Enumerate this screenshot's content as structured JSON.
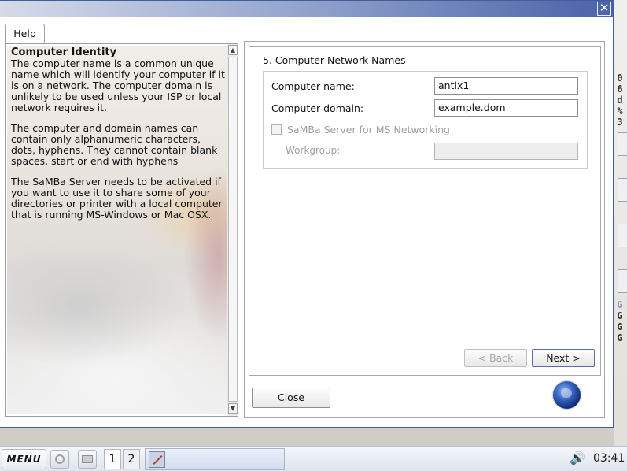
{
  "window": {
    "close_glyph": "✕"
  },
  "help": {
    "tab_label": "Help",
    "heading": "Computer Identity",
    "paragraphs": [
      "The computer name is a common unique name which will identify your computer if it is on a network. The computer domain is unlikely to be used unless your ISP or local network requires it.",
      "The computer and domain names can contain only alphanumeric characters, dots, hyphens. They cannot contain blank spaces, start or end with hyphens",
      "The SaMBa Server needs to be activated if you want to use it to share some of your directories or printer with a local computer that is running MS-Windows or Mac OSX."
    ]
  },
  "form": {
    "section_title": "5. Computer Network Names",
    "computer_name_label": "Computer name:",
    "computer_name_value": "antix1",
    "computer_domain_label": "Computer domain:",
    "computer_domain_value": "example.dom",
    "samba_label": "SaMBa Server for MS Networking",
    "samba_checked": false,
    "workgroup_label": "Workgroup:",
    "workgroup_value": ""
  },
  "buttons": {
    "back": "< Back",
    "next": "Next >",
    "close": "Close"
  },
  "desktop": {
    "right_strip_chars": [
      "0",
      "6",
      "d",
      "%",
      "3"
    ],
    "right_strip_chars_2": [
      "G",
      "G",
      "G",
      "G"
    ]
  },
  "taskbar": {
    "menu_label": "MENU",
    "workspace_1": "1",
    "workspace_2": "2",
    "clock": "03:41",
    "volume_glyph": "🔊"
  },
  "colors": {
    "titlebar_accent": "#4a63a8",
    "taskbar_bg": "#dfe4ee"
  }
}
